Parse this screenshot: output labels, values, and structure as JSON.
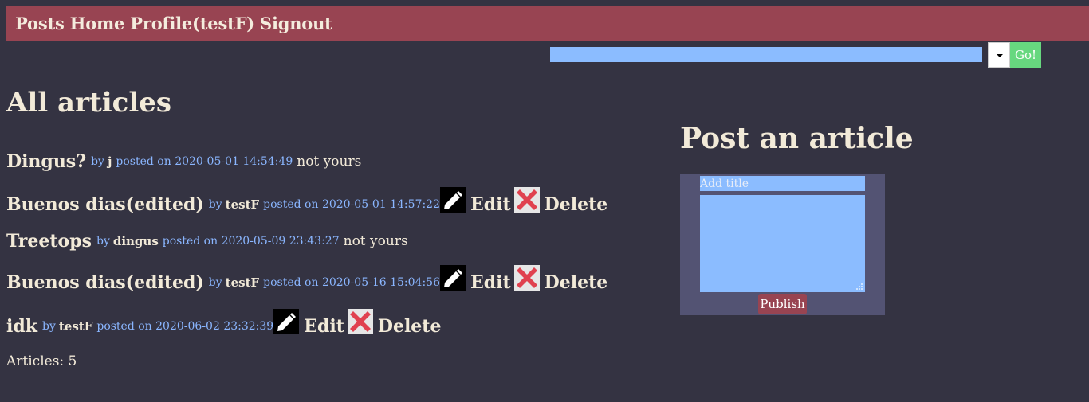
{
  "nav": {
    "links": [
      "Posts",
      "Home",
      "Profile(testF)",
      "Signout"
    ]
  },
  "search": {
    "go_label": "Go!"
  },
  "main": {
    "title": "All articles",
    "posts": [
      {
        "title": "Dingus?",
        "by": "by",
        "author": "j",
        "posted": "posted on 2020-05-01 14:54:49",
        "status": "not yours"
      },
      {
        "title": "Buenos dias(edited)",
        "by": "by",
        "author": "testF",
        "posted": "posted on 2020-05-01 14:57:22",
        "edit": "Edit",
        "delete": "Delete"
      },
      {
        "title": "Treetops",
        "by": "by",
        "author": "dingus",
        "posted": "posted on 2020-05-09 23:43:27",
        "status": "not yours"
      },
      {
        "title": "Buenos dias(edited)",
        "by": "by",
        "author": "testF",
        "posted": "posted on 2020-05-16 15:04:56",
        "edit": "Edit",
        "delete": "Delete"
      },
      {
        "title": "idk",
        "by": "by",
        "author": "testF",
        "posted": "posted on 2020-06-02 23:32:39",
        "edit": "Edit",
        "delete": "Delete"
      }
    ],
    "count_label": "Articles: 5"
  },
  "post_form": {
    "title": "Post an article",
    "title_placeholder": "Add title",
    "publish_label": "Publish"
  },
  "colors": {
    "background": "#343342",
    "navbar": "#984452",
    "input": "#8bbcff",
    "go_button": "#67d87f",
    "form_panel": "#535373",
    "meta_text": "#8ab6ff"
  },
  "icons": {
    "edit": "pencil-icon",
    "delete": "red-x-icon"
  }
}
